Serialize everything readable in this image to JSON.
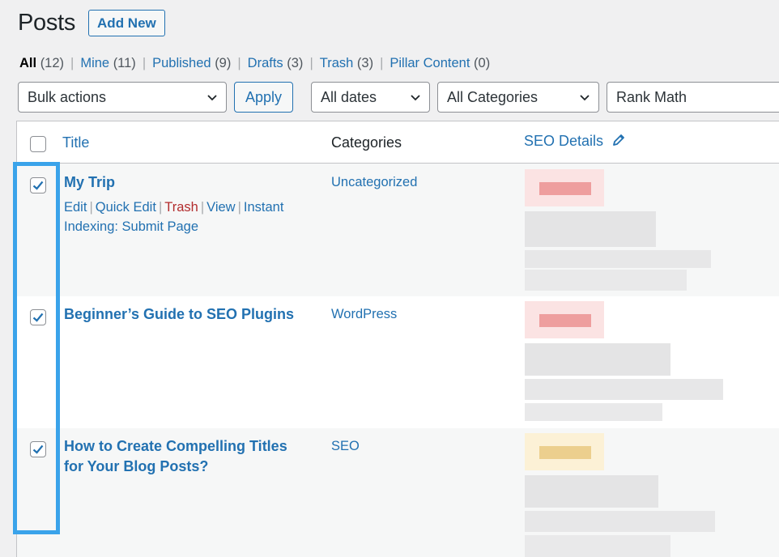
{
  "header": {
    "title": "Posts",
    "add_new": "Add New"
  },
  "filters": [
    {
      "label": "All",
      "count": "(12)",
      "current": true
    },
    {
      "label": "Mine",
      "count": "(11)"
    },
    {
      "label": "Published",
      "count": "(9)"
    },
    {
      "label": "Drafts",
      "count": "(3)"
    },
    {
      "label": "Trash",
      "count": "(3)"
    },
    {
      "label": "Pillar Content",
      "count": "(0)"
    }
  ],
  "tablenav": {
    "bulk_actions": "Bulk actions",
    "apply": "Apply",
    "dates": "All dates",
    "categories": "All Categories",
    "rank_math": "Rank Math"
  },
  "columns": {
    "title": "Title",
    "categories": "Categories",
    "seo": "SEO Details"
  },
  "row_actions": {
    "edit": "Edit",
    "quick_edit": "Quick Edit",
    "trash": "Trash",
    "view": "View",
    "instant": "Instant",
    "indexing": "Indexing: Submit Page"
  },
  "posts": [
    {
      "title": "My Trip",
      "category": "Uncategorized",
      "checked": true,
      "seo_color": "#f2a9a9"
    },
    {
      "title": "Beginner’s Guide to SEO Plugins",
      "category": "WordPress",
      "checked": true,
      "seo_color": "#f2a9a9"
    },
    {
      "title": "How to Create Compelling Titles for Your Blog Posts?",
      "category": "SEO",
      "checked": true,
      "seo_color": "#f3d9a0"
    }
  ],
  "colors": {
    "accent": "#2271b1",
    "highlight": "#3aa3ea",
    "trash": "#b32d2e"
  },
  "icons": {
    "checkbox": "checkmark-icon",
    "dropdown": "chevron-down-icon",
    "seo_edit": "pencil-icon"
  }
}
